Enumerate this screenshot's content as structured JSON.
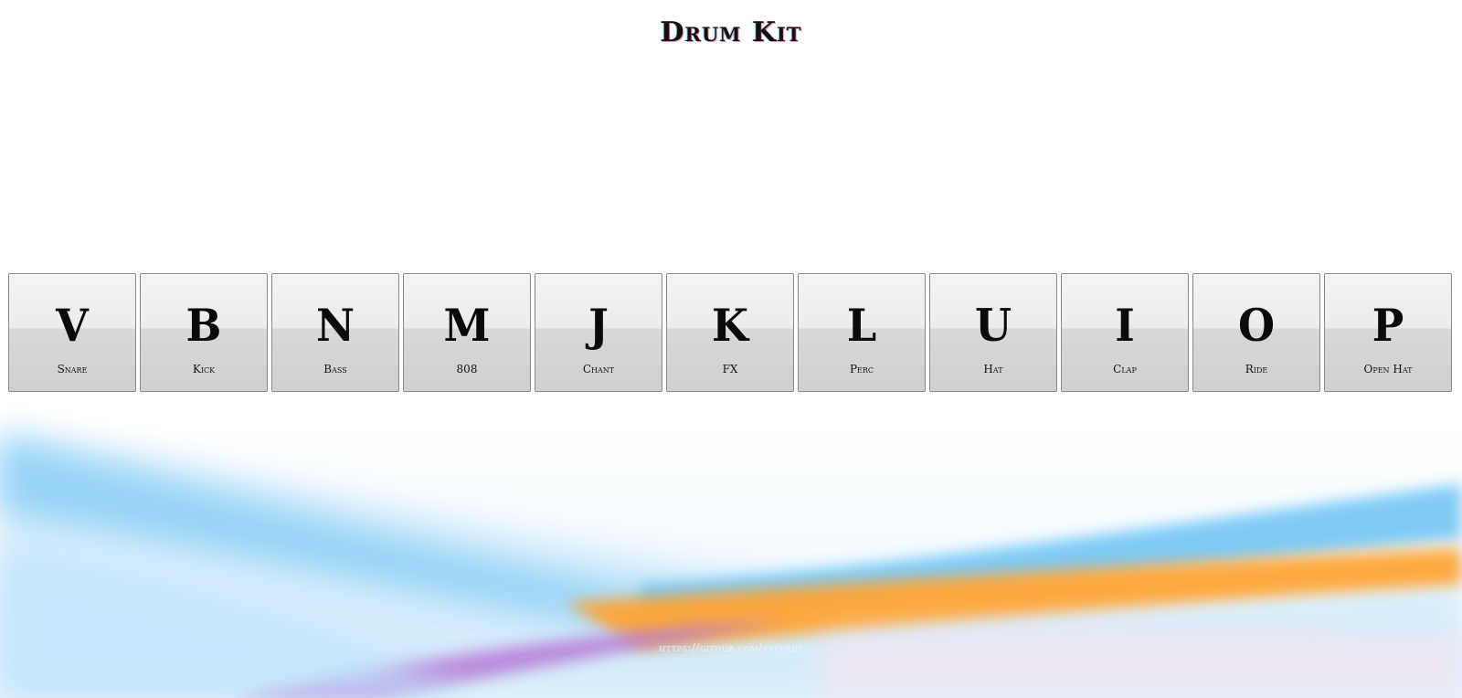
{
  "page": {
    "title": "Drum Kit"
  },
  "keys": [
    {
      "letter": "V",
      "sound": "Snare"
    },
    {
      "letter": "B",
      "sound": "Kick"
    },
    {
      "letter": "N",
      "sound": "Bass"
    },
    {
      "letter": "M",
      "sound": "808"
    },
    {
      "letter": "J",
      "sound": "Chant"
    },
    {
      "letter": "K",
      "sound": "FX"
    },
    {
      "letter": "L",
      "sound": "Perc"
    },
    {
      "letter": "U",
      "sound": "Hat"
    },
    {
      "letter": "I",
      "sound": "Clap"
    },
    {
      "letter": "O",
      "sound": "Ride"
    },
    {
      "letter": "P",
      "sound": "Open Hat"
    }
  ],
  "footer": {
    "link_text": "https://github.com/xvferdy"
  },
  "colors": {
    "key_top": "#f3f3f3",
    "key_bottom": "#d0d0d0",
    "key_border": "#8a8a8a",
    "wave_blue": "#6fc3f5",
    "wave_orange": "#ff9a2e",
    "wave_purple": "#b07ad8"
  }
}
